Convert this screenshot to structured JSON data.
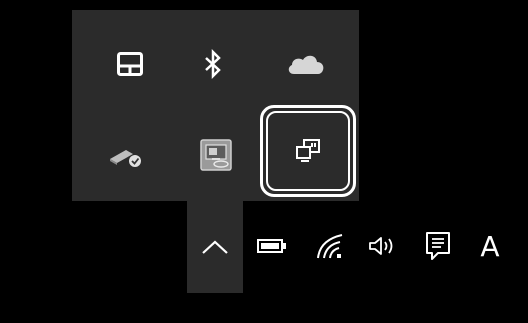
{
  "overflow_panel": {
    "icons": [
      {
        "name": "touchpad-icon",
        "tooltip": ""
      },
      {
        "name": "bluetooth-icon",
        "tooltip": ""
      },
      {
        "name": "onedrive-icon",
        "tooltip": ""
      },
      {
        "name": "usb-safely-remove-icon",
        "tooltip": ""
      },
      {
        "name": "intel-graphics-icon",
        "tooltip": ""
      },
      {
        "name": "display-switch-icon",
        "tooltip": "",
        "highlighted": true
      }
    ]
  },
  "taskbar": {
    "ime_label": "A",
    "icons": [
      "chevron-up-icon",
      "battery-icon",
      "wifi-icon",
      "volume-icon",
      "action-center-icon"
    ]
  },
  "colors": {
    "taskbar_bg": "#000000",
    "panel_bg": "#2b2b2b",
    "icon": "#ffffff",
    "highlight": "#ffffff"
  }
}
